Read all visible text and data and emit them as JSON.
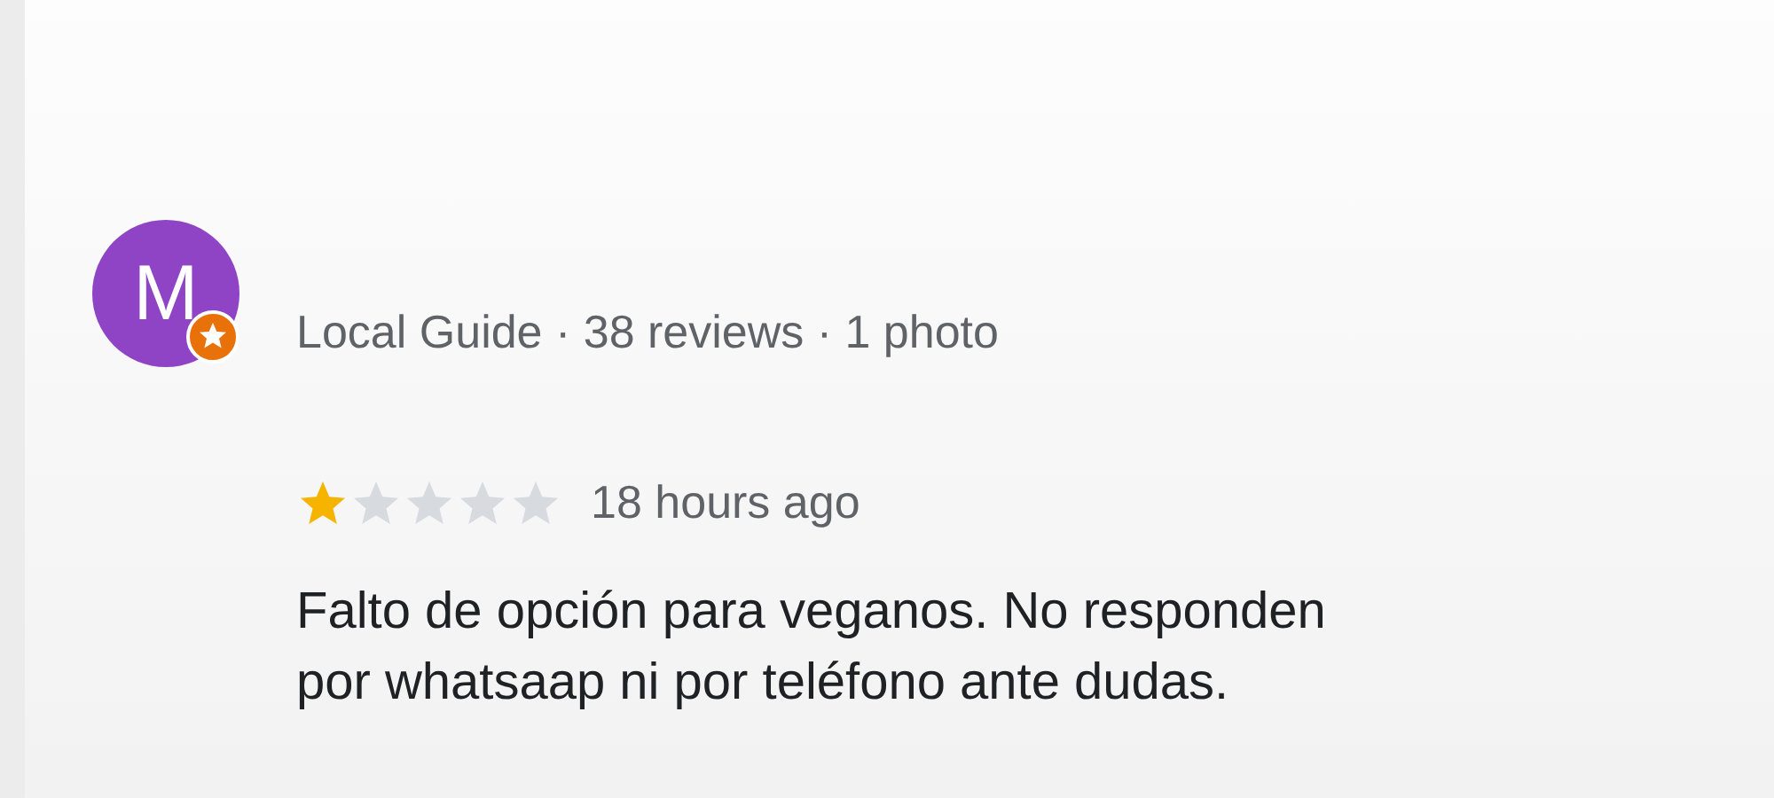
{
  "review": {
    "avatar_letter": "M",
    "local_guide": true,
    "meta": "Local Guide · 38 reviews · 1 photo",
    "stars": 1,
    "time": "18 hours ago",
    "text_lines": [
      "Falto de opción para veganos. No responden",
      "por whatsaap ni por teléfono ante dudas."
    ]
  }
}
